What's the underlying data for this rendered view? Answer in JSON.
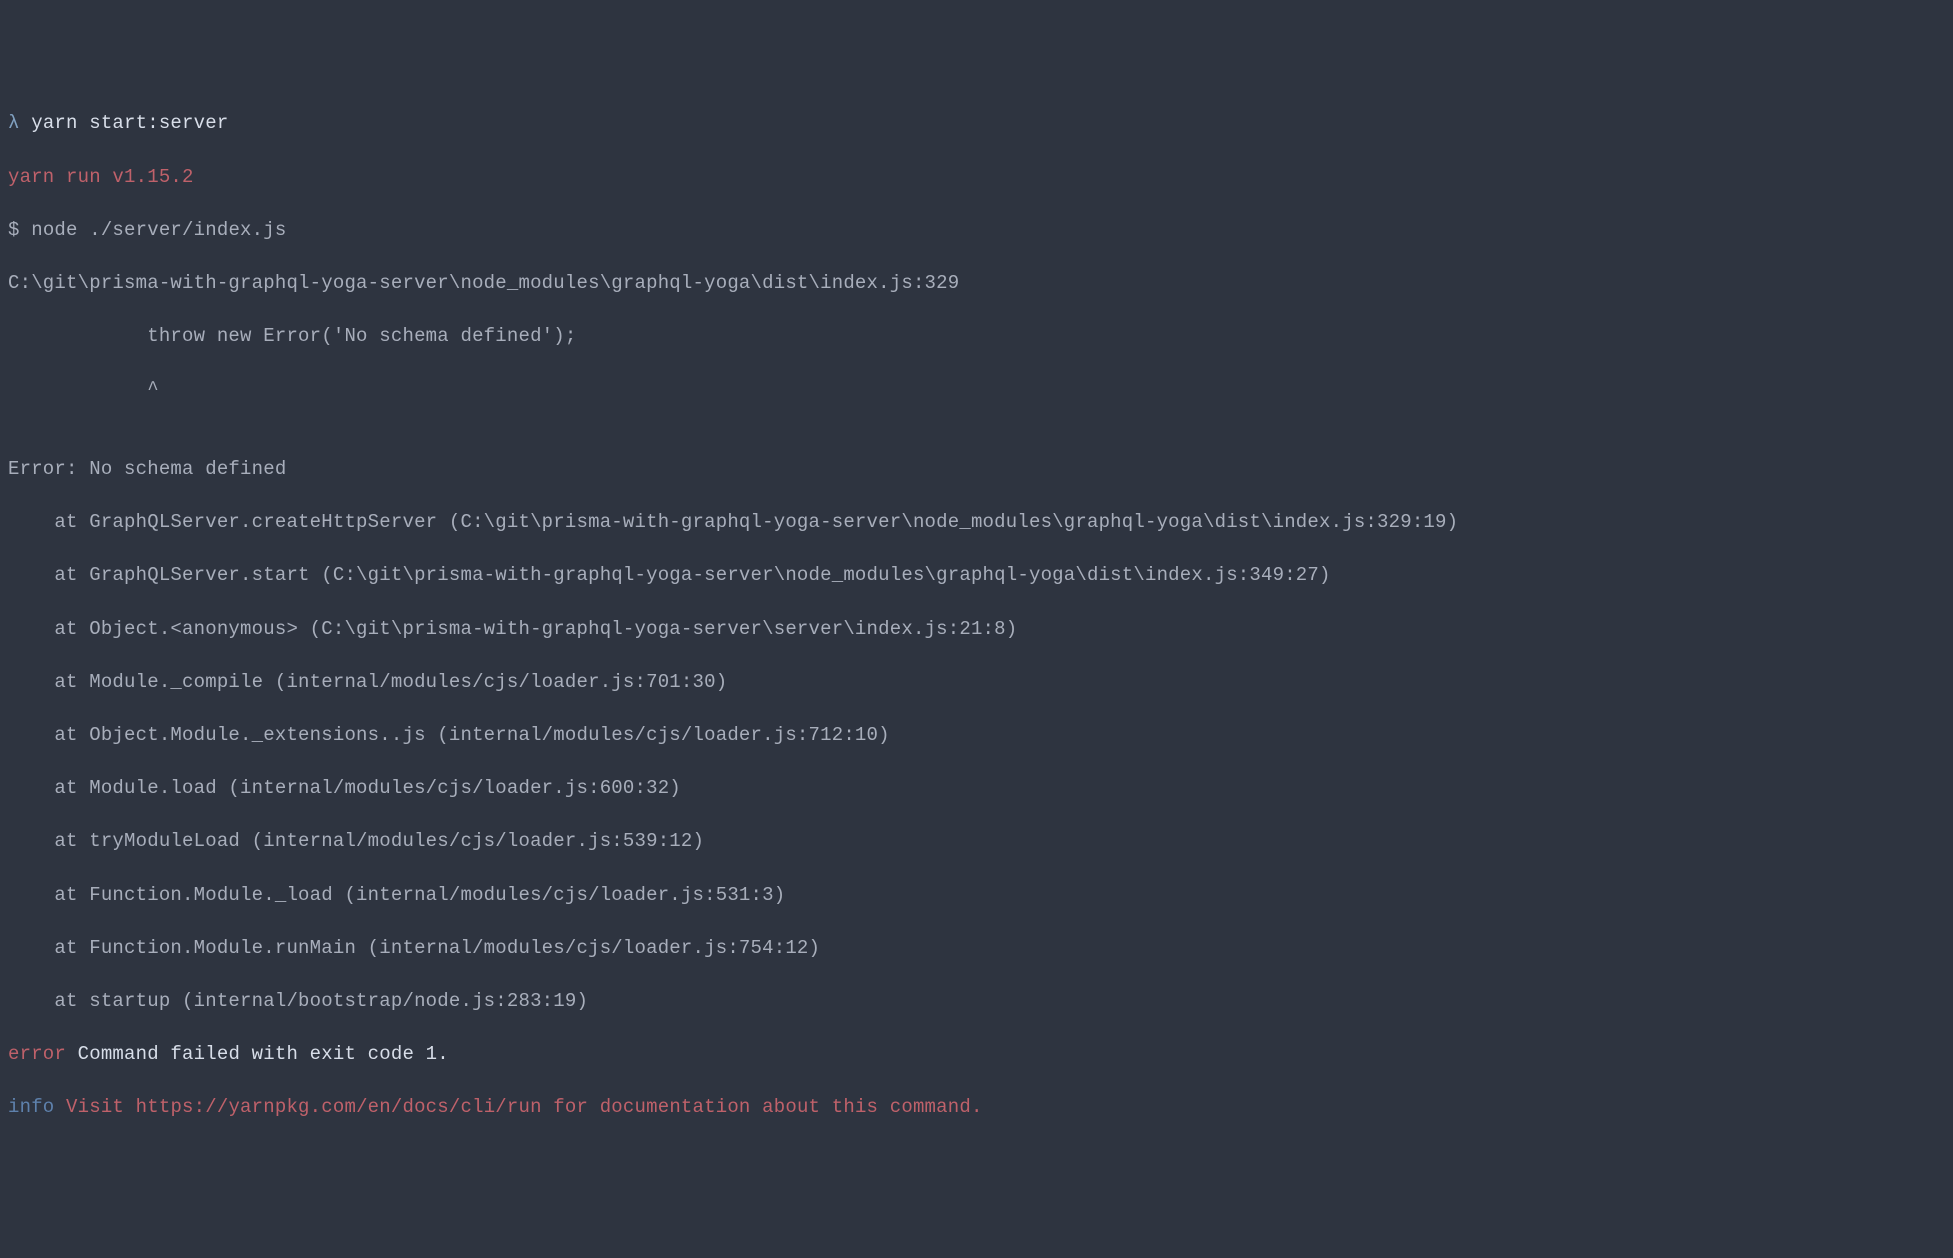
{
  "terminal": {
    "prompt_lambda": "λ",
    "command": " yarn start:server",
    "yarn_run": "yarn run v1.15.2",
    "dollar_prompt": "$",
    "node_cmd": " node ./server/index.js",
    "error_path": "C:\\git\\prisma-with-graphql-yoga-server\\node_modules\\graphql-yoga\\dist\\index.js:329",
    "throw_line": "            throw new Error('No schema defined');",
    "caret_line": "            ^",
    "blank": "",
    "error_header": "Error: No schema defined",
    "stack": [
      "    at GraphQLServer.createHttpServer (C:\\git\\prisma-with-graphql-yoga-server\\node_modules\\graphql-yoga\\dist\\index.js:329:19)",
      "    at GraphQLServer.start (C:\\git\\prisma-with-graphql-yoga-server\\node_modules\\graphql-yoga\\dist\\index.js:349:27)",
      "    at Object.<anonymous> (C:\\git\\prisma-with-graphql-yoga-server\\server\\index.js:21:8)",
      "    at Module._compile (internal/modules/cjs/loader.js:701:30)",
      "    at Object.Module._extensions..js (internal/modules/cjs/loader.js:712:10)",
      "    at Module.load (internal/modules/cjs/loader.js:600:32)",
      "    at tryModuleLoad (internal/modules/cjs/loader.js:539:12)",
      "    at Function.Module._load (internal/modules/cjs/loader.js:531:3)",
      "    at Function.Module.runMain (internal/modules/cjs/loader.js:754:12)",
      "    at startup (internal/bootstrap/node.js:283:19)"
    ],
    "error_label": "error",
    "error_msg": " Command failed with exit code 1.",
    "info_label": "info",
    "info_msg": " Visit https://yarnpkg.com/en/docs/cli/run for documentation about this command."
  }
}
